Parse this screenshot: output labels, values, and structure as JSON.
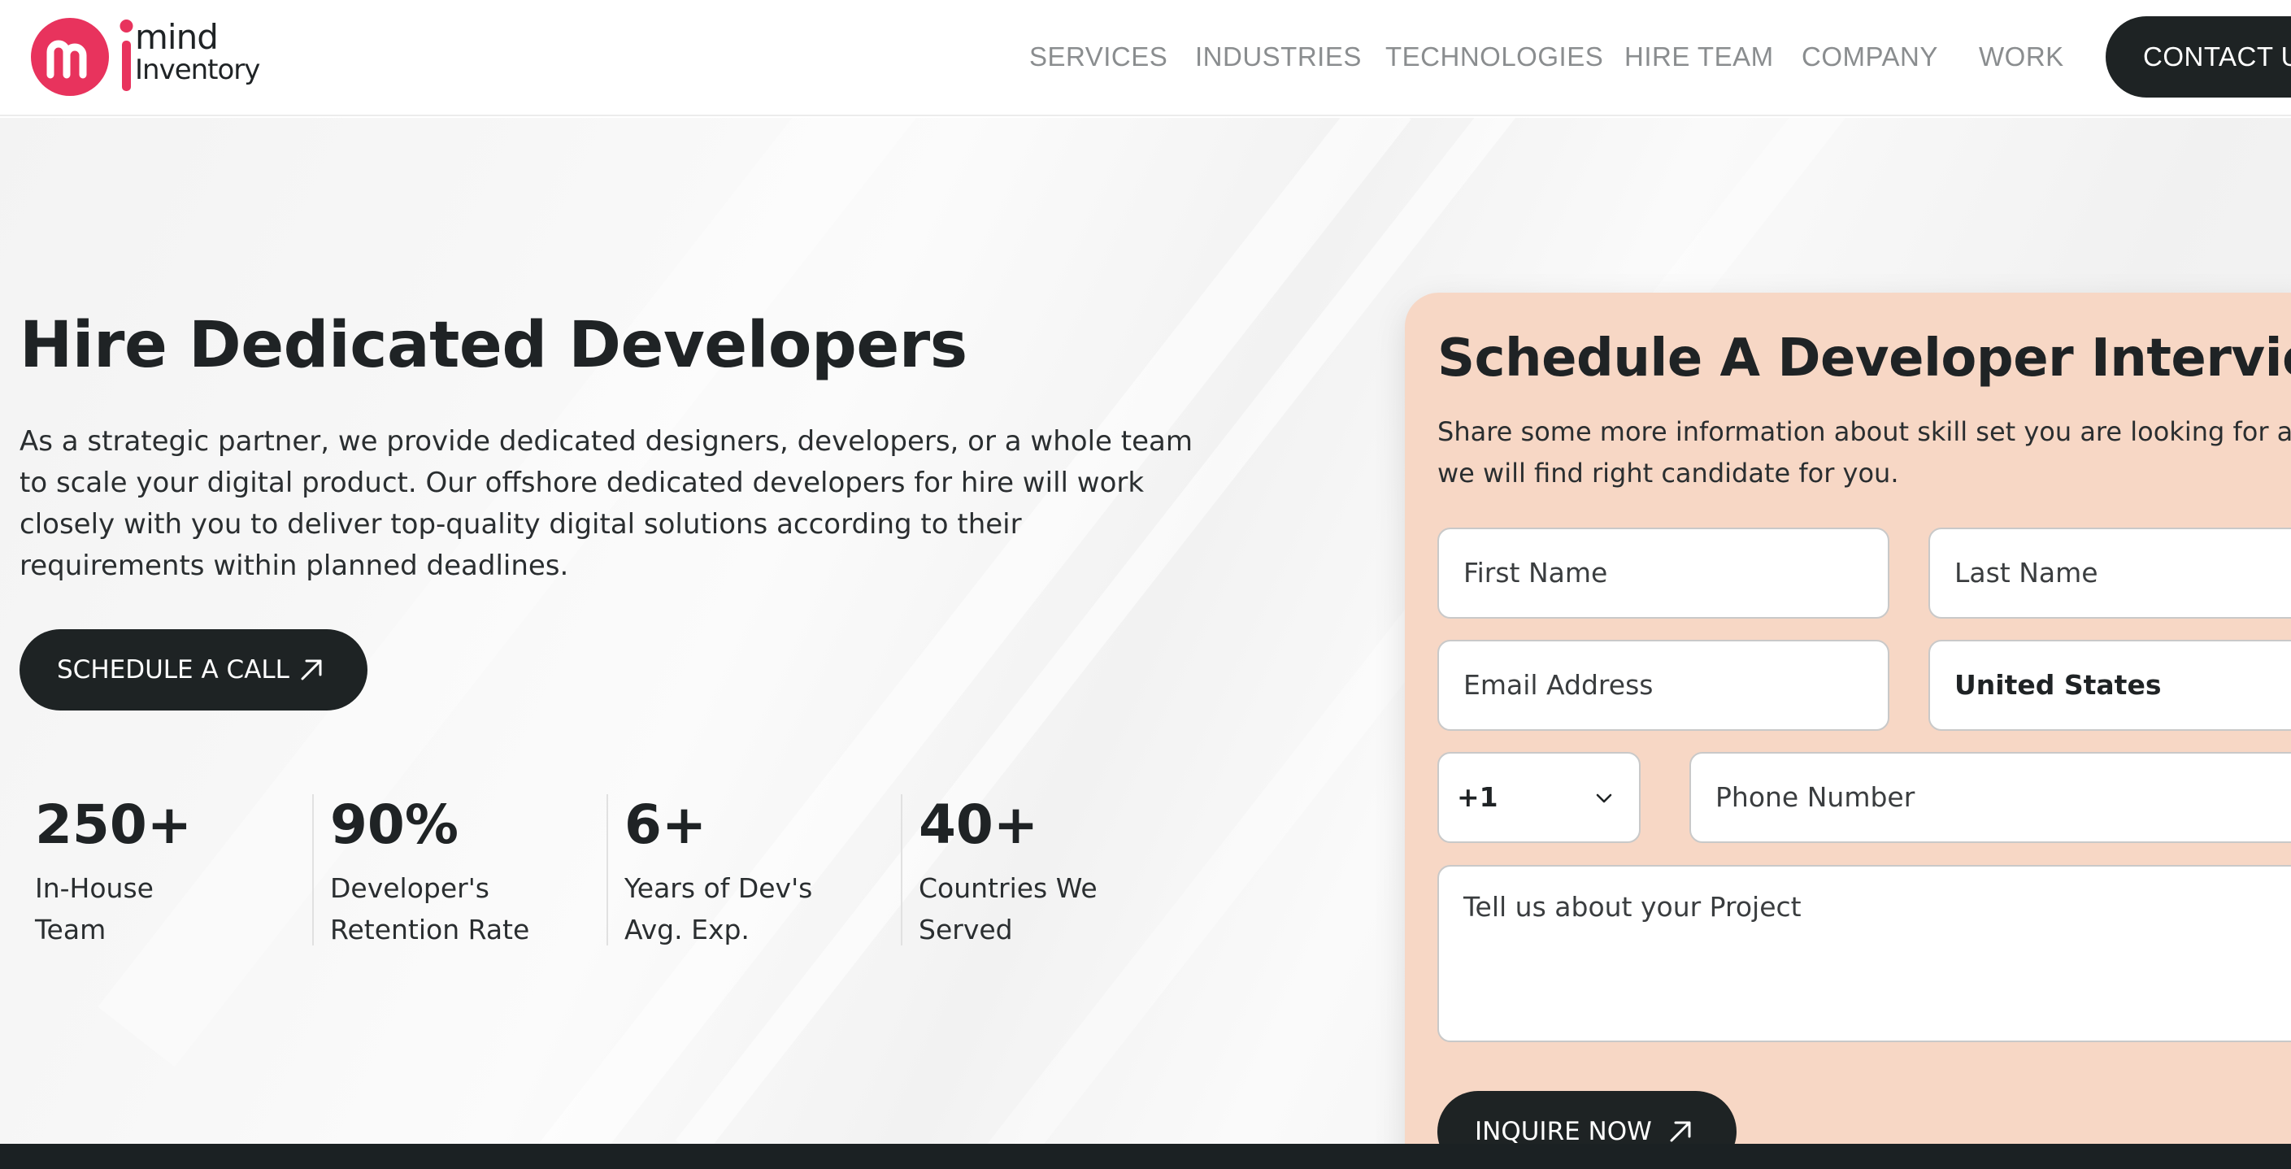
{
  "brand": {
    "line1": "mind",
    "line2": "Inventory"
  },
  "nav": {
    "items": [
      "SERVICES",
      "INDUSTRIES",
      "TECHNOLOGIES",
      "HIRE TEAM",
      "COMPANY",
      "WORK"
    ],
    "contact_label": "CONTACT US"
  },
  "hero": {
    "title": "Hire Dedicated Developers",
    "description": "As a strategic partner, we provide dedicated designers, developers, or a whole team to scale your digital product. Our offshore dedicated developers for hire will work closely with you to deliver top-quality digital solutions according to their requirements within planned deadlines.",
    "cta_label": "SCHEDULE A CALL",
    "cta_icon": "arrow-up-right-icon"
  },
  "stats": [
    {
      "value": "250+",
      "label": "In-House Team"
    },
    {
      "value": "90%",
      "label": "Developer's Retention Rate"
    },
    {
      "value": "6+",
      "label": "Years of Dev's Avg. Exp."
    },
    {
      "value": "40+",
      "label": "Countries We Served"
    }
  ],
  "form": {
    "title": "Schedule A Developer Interview",
    "description": "Share some more information about skill set you are looking for and we will find right candidate for you.",
    "first_name_placeholder": "First Name",
    "last_name_placeholder": "Last Name",
    "email_placeholder": "Email Address",
    "country_value": "United States",
    "dial_code_value": "+1",
    "phone_placeholder": "Phone Number",
    "project_placeholder": "Tell us about your Project",
    "submit_label": "INQUIRE NOW",
    "submit_icon": "arrow-up-right-icon"
  },
  "colors": {
    "brand_red": "#e8335d",
    "dark": "#1e2324",
    "form_background": "#f7d7c5",
    "nav_text": "#8a8d8f"
  }
}
